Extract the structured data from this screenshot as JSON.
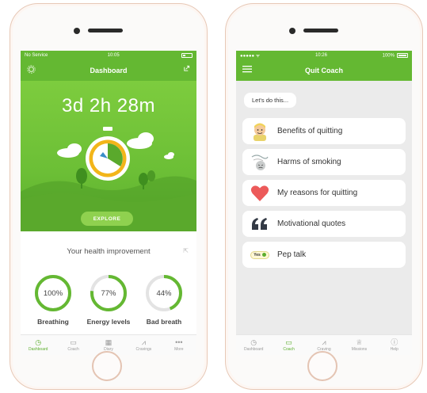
{
  "colors": {
    "brand_green": "#64b832",
    "accent_green": "#5cae2d",
    "ring_track": "#e3e3e3"
  },
  "left": {
    "status": {
      "carrier": "No Service",
      "time": "10:05"
    },
    "navbar": {
      "title": "Dashboard",
      "left_icon": "gear-icon",
      "right_icon": "share-icon"
    },
    "hero": {
      "timer": "3d 2h 28m",
      "explore_label": "EXPLORE"
    },
    "health": {
      "title": "Your health improvement",
      "rings": [
        {
          "value_text": "100%",
          "fraction": 1.0,
          "label": "Breathing"
        },
        {
          "value_text": "77%",
          "fraction": 0.77,
          "label": "Energy levels"
        },
        {
          "value_text": "44%",
          "fraction": 0.44,
          "label": "Bad breath"
        }
      ]
    },
    "tabs": [
      {
        "label": "Dashboard",
        "icon": "clock-icon",
        "active": true
      },
      {
        "label": "Coach",
        "icon": "chat-icon",
        "active": false
      },
      {
        "label": "Diary",
        "icon": "calendar-icon",
        "active": false
      },
      {
        "label": "Cravings",
        "icon": "chart-icon",
        "active": false
      },
      {
        "label": "More",
        "icon": "more-icon",
        "active": false
      }
    ]
  },
  "right": {
    "status": {
      "carrier": "",
      "time": "10:26",
      "battery": "100%"
    },
    "navbar": {
      "title": "Quit Coach",
      "left_icon": "menu-icon"
    },
    "intro": "Let's do this...",
    "items": [
      {
        "label": "Benefits of quitting",
        "icon": "person-icon"
      },
      {
        "label": "Harms of smoking",
        "icon": "sick-face-icon"
      },
      {
        "label": "My reasons for quitting",
        "icon": "heart-icon"
      },
      {
        "label": "Motivational quotes",
        "icon": "quote-icon"
      },
      {
        "label": "Pep talk",
        "icon": "yes-toggle-icon",
        "badge": "Yes"
      }
    ],
    "tabs": [
      {
        "label": "Dashboard",
        "icon": "clock-icon",
        "active": false
      },
      {
        "label": "Coach",
        "icon": "chat-icon",
        "active": true
      },
      {
        "label": "Craving",
        "icon": "chart-icon",
        "active": false
      },
      {
        "label": "Missions",
        "icon": "trophy-icon",
        "active": false
      },
      {
        "label": "Help",
        "icon": "info-icon",
        "active": false
      }
    ]
  }
}
